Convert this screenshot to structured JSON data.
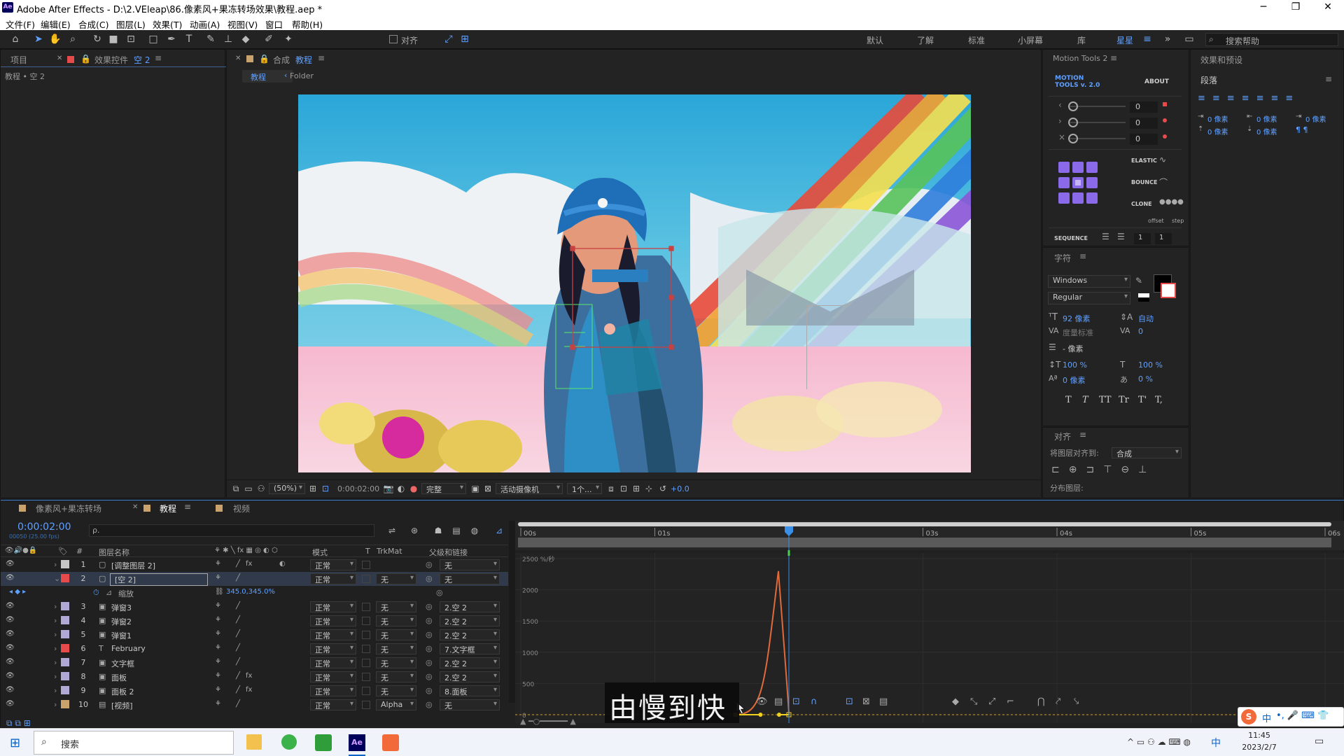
{
  "window": {
    "app_badge": "Ae",
    "title": "Adobe After Effects - D:\\2.VEleap\\86.像素风+果冻转场效果\\教程.aep *",
    "minimize": "─",
    "maximize": "❐",
    "close": "✕"
  },
  "menu": [
    "文件(F)",
    "编辑(E)",
    "合成(C)",
    "图层(L)",
    "效果(T)",
    "动画(A)",
    "视图(V)",
    "窗口",
    "帮助(H)"
  ],
  "toolbar": {
    "align_label": "对齐",
    "workspaces": [
      "默认",
      "了解",
      "标准",
      "小屏幕",
      "库",
      "星星"
    ],
    "active_workspace": "星星",
    "search_placeholder": "搜索帮助"
  },
  "project_panel": {
    "tab_project": "项目",
    "tab_effects": "效果控件",
    "effects_target": "空 2",
    "breadcrumb": "教程 • 空 2"
  },
  "comp_panel": {
    "tab_label": "合成",
    "comp_name": "教程",
    "crumb_active": "教程",
    "crumb_folder": "Folder",
    "zoom": "(50%)",
    "timecode": "0:00:02:00",
    "resolution": "完整",
    "camera": "活动摄像机",
    "views": "1个...",
    "exposure": "+0.0"
  },
  "motion_tools": {
    "title": "Motion Tools 2",
    "logo_line1": "MOTION",
    "logo_line2": "TOOLS v. 2.0",
    "about": "ABOUT",
    "values": [
      "0",
      "0",
      "0"
    ],
    "elastic": "ELASTIC",
    "bounce": "BOUNCE",
    "clone": "CLONE",
    "offset": "offset",
    "step": "step",
    "sequence": "SEQUENCE",
    "seq_values": [
      "1",
      "1"
    ]
  },
  "effects_presets": {
    "title": "效果和预设",
    "paragraph": "段落",
    "px_rows": [
      "0 像素",
      "0 像素",
      "0 像素",
      "0 像素",
      "0 像素",
      "0 像素"
    ]
  },
  "character": {
    "title": "字符",
    "font": "Windows",
    "style": "Regular",
    "size": "92 像素",
    "leading": "自动",
    "kerning": "度量标准",
    "tracking": "0",
    "stroke": "- 像素",
    "vscale": "100 %",
    "hscale": "100 %",
    "baseline": "0 像素",
    "tsume": "0 %",
    "styles": [
      "T",
      "T",
      "TT",
      "Tr",
      "T'",
      "T,"
    ]
  },
  "align_panel": {
    "title": "对齐",
    "align_to_label": "将图层对齐到:",
    "align_to": "合成",
    "distribute": "分布图层:"
  },
  "timeline": {
    "tabs": [
      "像素风+果冻转场",
      "教程",
      "视频"
    ],
    "active_tab": "教程",
    "timecode": "0:00:02:00",
    "fps": "00050 (25.00 fps)",
    "search_placeholder": "ρ.",
    "col_headers": {
      "num": "#",
      "name": "图层名称",
      "mode": "模式",
      "t": "T",
      "trkmat": "TrkMat",
      "parent": "父级和链接"
    },
    "layers": [
      {
        "num": "1",
        "name": "[调整图层 2]",
        "color": "#c7c7c7",
        "mode": "正常",
        "trk": "",
        "parent": "无",
        "fx": true,
        "icon": "box"
      },
      {
        "num": "2",
        "name": "[空 2]",
        "color": "#e64a4a",
        "mode": "正常",
        "trk": "无",
        "parent": "无",
        "fx": false,
        "icon": "box",
        "selected": true
      },
      {
        "num": "3",
        "name": "弹窗3",
        "color": "#b0a9d6",
        "mode": "正常",
        "trk": "无",
        "parent": "2.空 2",
        "fx": false,
        "icon": "comp"
      },
      {
        "num": "4",
        "name": "弹窗2",
        "color": "#b0a9d6",
        "mode": "正常",
        "trk": "无",
        "parent": "2.空 2",
        "fx": false,
        "icon": "comp"
      },
      {
        "num": "5",
        "name": "弹窗1",
        "color": "#b0a9d6",
        "mode": "正常",
        "trk": "无",
        "parent": "2.空 2",
        "fx": false,
        "icon": "comp"
      },
      {
        "num": "6",
        "name": "February",
        "color": "#e64a4a",
        "mode": "正常",
        "trk": "无",
        "parent": "7.文字框",
        "fx": false,
        "icon": "text"
      },
      {
        "num": "7",
        "name": "文字框",
        "color": "#b0a9d6",
        "mode": "正常",
        "trk": "无",
        "parent": "2.空 2",
        "fx": false,
        "icon": "comp"
      },
      {
        "num": "8",
        "name": "面板",
        "color": "#b0a9d6",
        "mode": "正常",
        "trk": "无",
        "parent": "2.空 2",
        "fx": true,
        "icon": "comp"
      },
      {
        "num": "9",
        "name": "面板 2",
        "color": "#b0a9d6",
        "mode": "正常",
        "trk": "无",
        "parent": "8.面板",
        "fx": true,
        "icon": "comp"
      },
      {
        "num": "10",
        "name": "[视频]",
        "color": "#c9a36b",
        "mode": "正常",
        "trk": "Alpha",
        "parent": "无",
        "fx": false,
        "icon": "video"
      }
    ],
    "scale_prop": {
      "name": "缩放",
      "value": "345.0,345.0%"
    },
    "ruler": [
      "00s",
      "01s",
      "03s",
      "04s",
      "05s",
      "06s"
    ],
    "graph_axis": [
      "2500 %/秒",
      "2000",
      "1500",
      "1000",
      "500",
      "0"
    ],
    "graph_peak": 2300
  },
  "caption": "由慢到快",
  "taskbar": {
    "search": "搜索",
    "time": "11:45",
    "date": "2023/2/7",
    "ime": "中"
  }
}
